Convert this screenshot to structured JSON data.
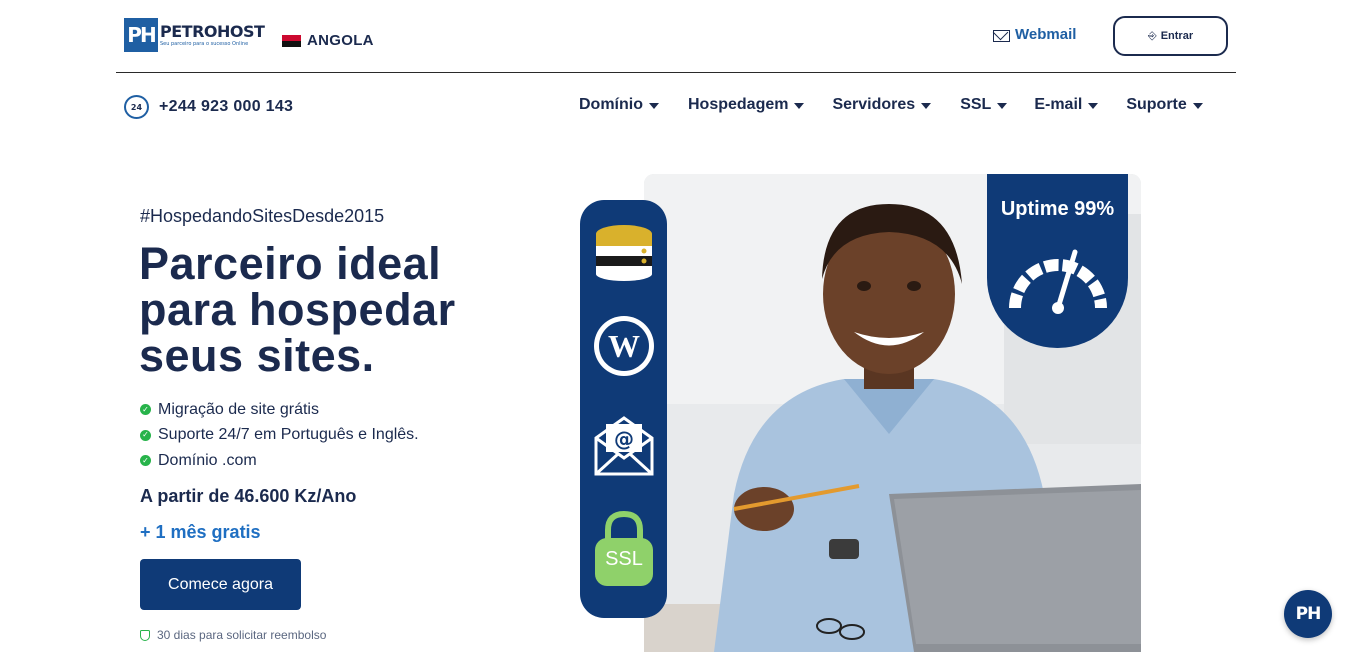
{
  "header": {
    "logo_mark": "PH",
    "logo_name": "PETROHOST",
    "logo_tagline": "Seu parceiro para o sucesso Online",
    "country": "ANGOLA",
    "webmail_label": "Webmail",
    "entrar_label": "Entrar",
    "entrar_icon": "login-icon"
  },
  "nav": {
    "phone": "+244 923 000 143",
    "phone_icon_text": "24",
    "items": [
      {
        "label": "Domínio"
      },
      {
        "label": "Hospedagem"
      },
      {
        "label": "Servidores"
      },
      {
        "label": "SSL"
      },
      {
        "label": "E-mail"
      },
      {
        "label": "Suporte"
      }
    ]
  },
  "hero": {
    "hashtag": "#HospedandoSitesDesde2015",
    "headline": "Parceiro ideal para hospedar seus sites.",
    "features": [
      "Migração de site grátis",
      "Suporte 24/7 em Português e Inglês.",
      "Domínio .com"
    ],
    "price": "A partir de 46.600 Kz/Ano",
    "bonus": "+ 1 mês gratis",
    "cta_label": "Comece agora",
    "refund_note": "30 dias para solicitar reembolso",
    "rail_icons": [
      "database-icon",
      "wordpress-icon",
      "email-icon",
      "ssl-lock-icon"
    ],
    "ssl_text": "SSL",
    "uptime_label": "Uptime 99%"
  },
  "chat_badge": "PH",
  "colors": {
    "navy": "#1b2a4e",
    "brand_blue": "#0f3a77",
    "link_blue": "#1f6fc2",
    "check_green": "#27b34a"
  }
}
